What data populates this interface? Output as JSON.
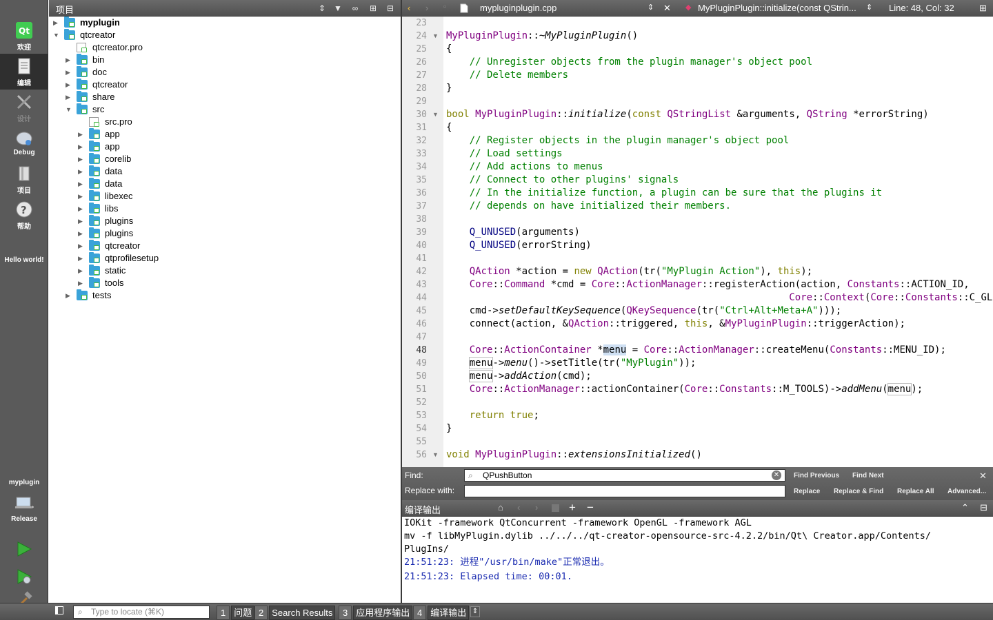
{
  "modebar": {
    "modes": [
      {
        "label": "欢迎",
        "icon": "qt-logo-icon"
      },
      {
        "label": "编辑",
        "icon": "edit-document-icon"
      },
      {
        "label": "设计",
        "icon": "design-tools-icon"
      },
      {
        "label": "Debug",
        "icon": "debug-icon"
      },
      {
        "label": "项目",
        "icon": "project-icon"
      },
      {
        "label": "帮助",
        "icon": "help-icon"
      }
    ],
    "project_name": "Hello world!",
    "kit_project": "myplugin",
    "kit_build": "Release"
  },
  "project_panel": {
    "title": "项目",
    "tree": [
      {
        "label": "myplugin"
      },
      {
        "label": "qtcreator"
      },
      {
        "label": "qtcreator.pro"
      },
      {
        "label": "bin"
      },
      {
        "label": "doc"
      },
      {
        "label": "qtcreator"
      },
      {
        "label": "share"
      },
      {
        "label": "src"
      },
      {
        "label": "src.pro"
      },
      {
        "label": "app"
      },
      {
        "label": "app"
      },
      {
        "label": "corelib"
      },
      {
        "label": "data"
      },
      {
        "label": "data"
      },
      {
        "label": "libexec"
      },
      {
        "label": "libs"
      },
      {
        "label": "plugins"
      },
      {
        "label": "plugins"
      },
      {
        "label": "qtcreator"
      },
      {
        "label": "qtprofilesetup"
      },
      {
        "label": "static"
      },
      {
        "label": "tools"
      },
      {
        "label": "tests"
      }
    ]
  },
  "editor": {
    "file_name": "mypluginplugin.cpp",
    "symbol": "MyPluginPlugin::initialize(const QStrin...",
    "position": "Line: 48, Col: 32",
    "current_line": "48",
    "line_numbers": [
      "23",
      "24",
      "25",
      "26",
      "27",
      "28",
      "29",
      "30",
      "31",
      "32",
      "33",
      "34",
      "35",
      "36",
      "37",
      "38",
      "39",
      "40",
      "41",
      "42",
      "43",
      "44",
      "45",
      "46",
      "47",
      "48",
      "49",
      "50",
      "51",
      "52",
      "53",
      "54",
      "55",
      "56"
    ]
  },
  "find": {
    "find_label": "Find:",
    "replace_label": "Replace with:",
    "find_value": "QPushButton",
    "replace_value": "",
    "find_previous": "Find Previous",
    "find_next": "Find Next",
    "replace": "Replace",
    "replace_find": "Replace & Find",
    "replace_all": "Replace All",
    "advanced": "Advanced..."
  },
  "output": {
    "title": "编译输出",
    "lines": [
      "IOKit -framework QtConcurrent -framework OpenGL -framework AGL",
      "mv -f libMyPlugin.dylib ../../../qt-creator-opensource-src-4.2.2/bin/Qt\\ Creator.app/Contents/",
      "PlugIns/",
      "21:51:23: 进程\"/usr/bin/make\"正常退出。",
      "21:51:23: Elapsed time: 00:01."
    ]
  },
  "statusbar": {
    "locator_placeholder": "Type to locate (⌘K)",
    "tabs": [
      {
        "num": "1",
        "name": "问题"
      },
      {
        "num": "2",
        "name": "Search Results"
      },
      {
        "num": "3",
        "name": "应用程序输出"
      },
      {
        "num": "4",
        "name": "编译输出"
      }
    ]
  }
}
